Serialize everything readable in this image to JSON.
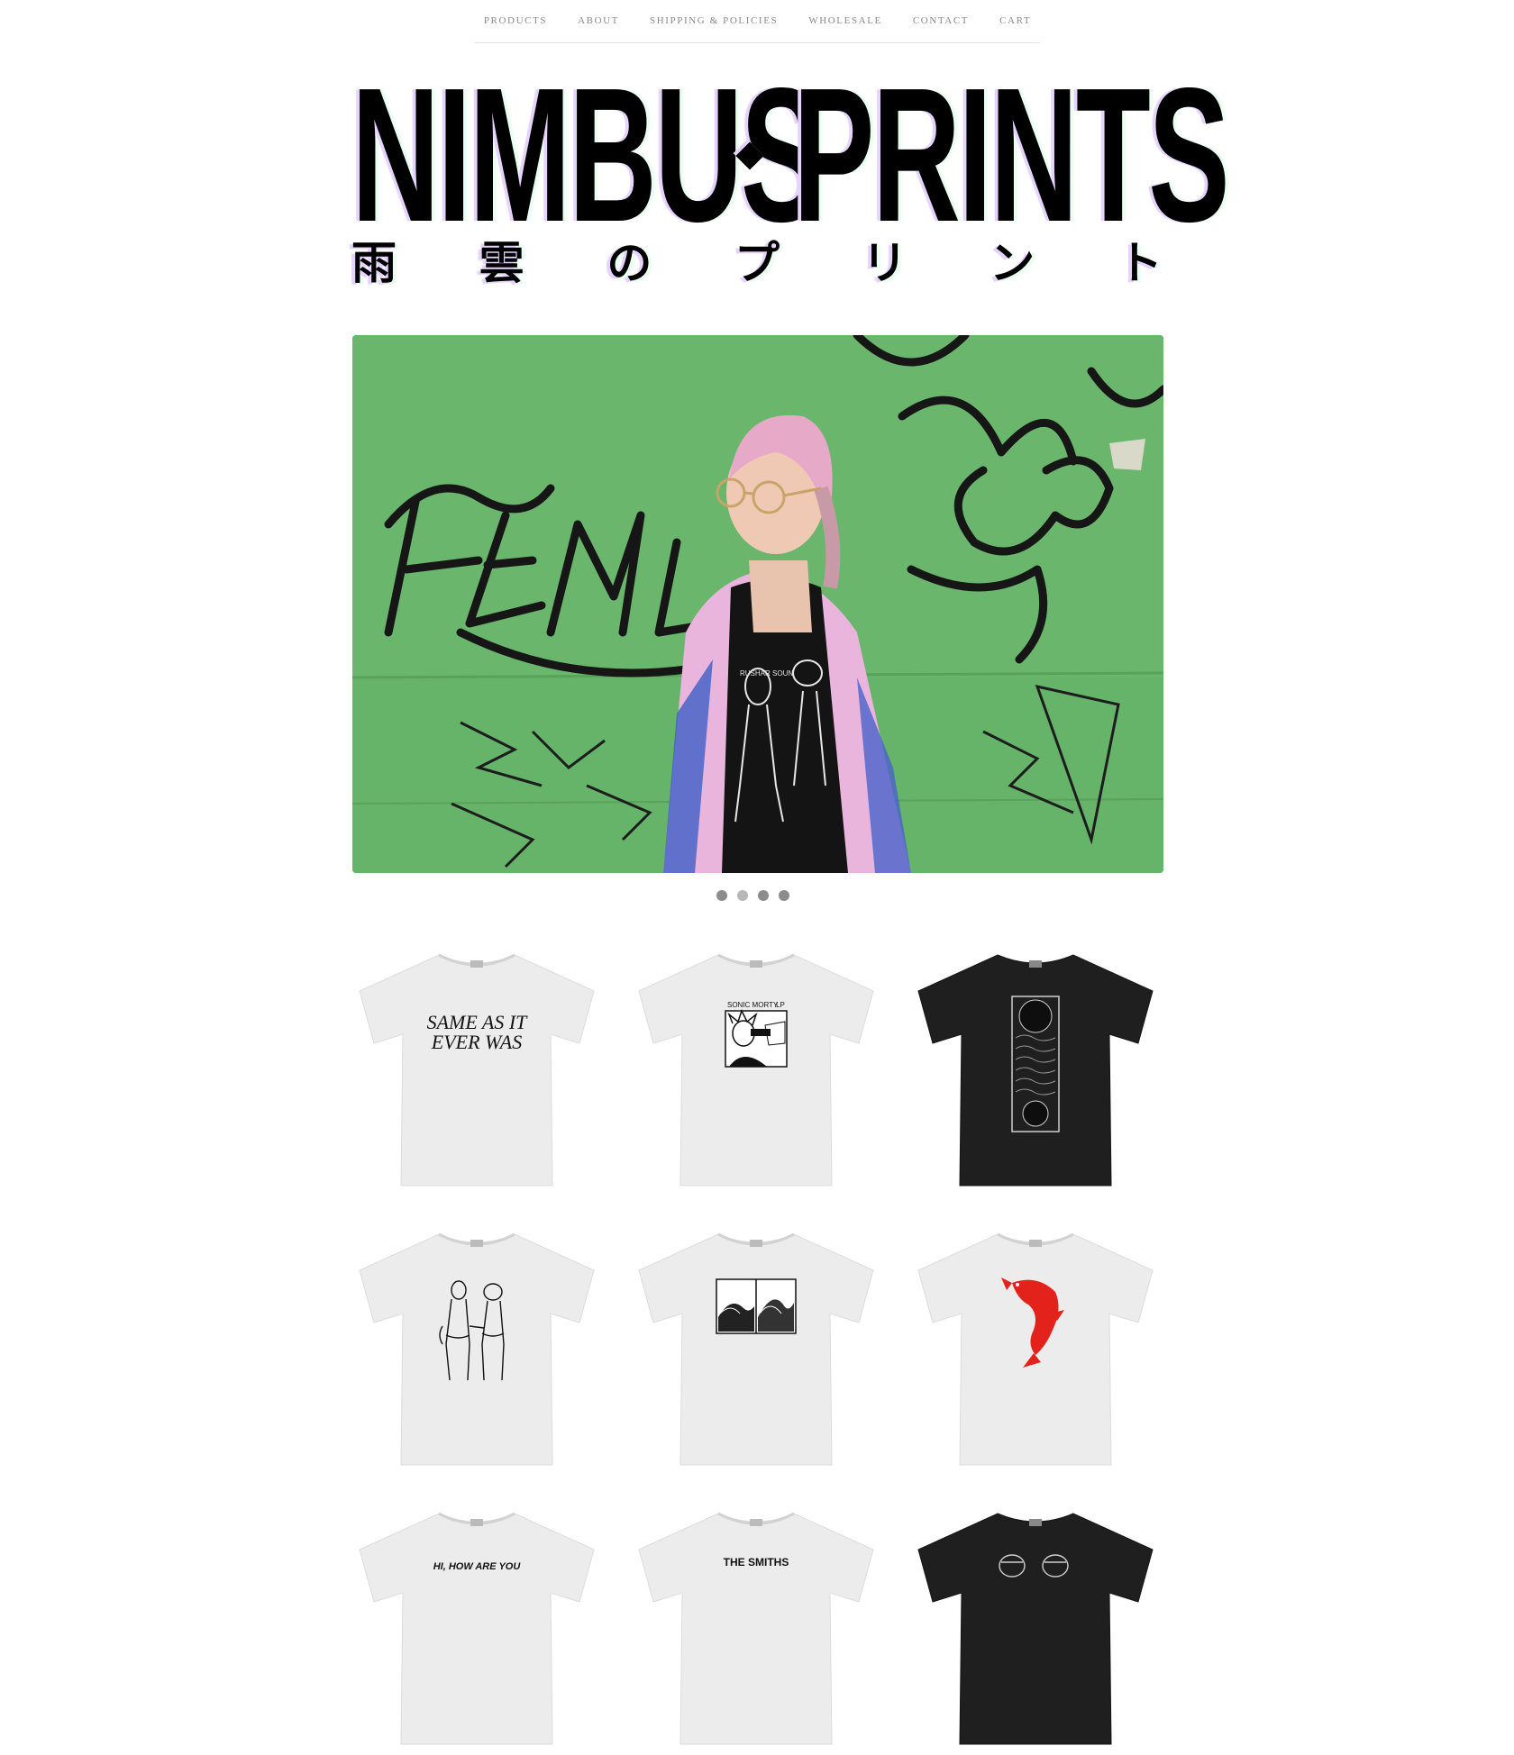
{
  "nav": {
    "items": [
      {
        "label": "PRODUCTS"
      },
      {
        "label": "ABOUT"
      },
      {
        "label": "SHIPPING & POLICIES"
      },
      {
        "label": "WHOLESALE"
      },
      {
        "label": "CONTACT"
      },
      {
        "label": "CART"
      }
    ]
  },
  "logo": {
    "word_left": "NIMBUS",
    "word_right": "PRINTS",
    "jp_chars": [
      "雨",
      "雲",
      "の",
      "プ",
      "リ",
      "ン",
      "ト"
    ]
  },
  "hero": {
    "slides_count": 4,
    "active_slide": 1,
    "shirt_print_text": "RUSHAR SOUN"
  },
  "products": [
    {
      "shirt_color": "white",
      "print_text": [
        "SAME AS IT",
        "EVER WAS"
      ]
    },
    {
      "shirt_color": "white",
      "print_text": [
        "SONIC MORTY",
        "LP"
      ]
    },
    {
      "shirt_color": "black",
      "print_text": []
    },
    {
      "shirt_color": "white",
      "print_text": []
    },
    {
      "shirt_color": "white",
      "print_text": []
    },
    {
      "shirt_color": "white",
      "print_text": []
    },
    {
      "shirt_color": "white",
      "print_text": [
        "HI, HOW ARE YOU"
      ]
    },
    {
      "shirt_color": "white",
      "print_text": [
        "THE SMITHS"
      ]
    },
    {
      "shirt_color": "black",
      "print_text": []
    }
  ],
  "colors": {
    "nav_text": "#8a8a8a",
    "hero_wall": "#63b266",
    "koi_red": "#e3231b",
    "shirt_white": "#ececec",
    "shirt_black": "#1f1f1f"
  }
}
